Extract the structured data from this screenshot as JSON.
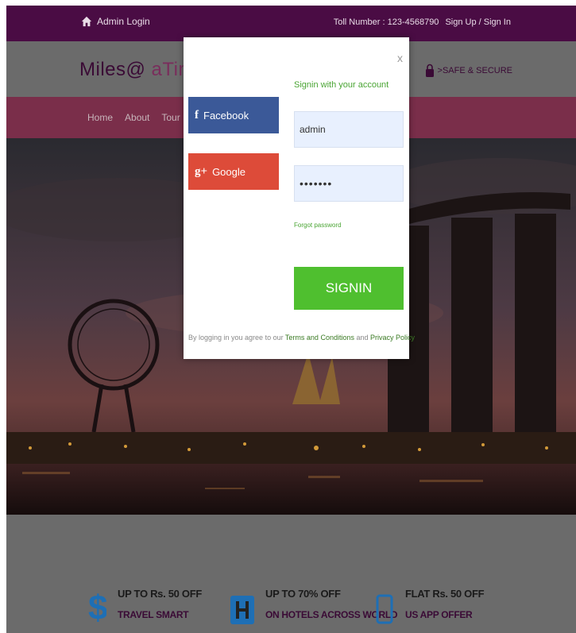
{
  "topbar": {
    "admin_login": "Admin Login",
    "toll_number": "Toll Number : 123-4568790",
    "signup_signin": "Sign Up / Sign In"
  },
  "brand": {
    "name_part1": "Miles@",
    "name_part2": " aTime",
    "secure_text": ">SAFE & SECURE"
  },
  "nav": {
    "items": [
      "Home",
      "About",
      "Tour Package"
    ]
  },
  "modal": {
    "close_symbol": "x",
    "facebook_label": "Facebook",
    "google_label": "Google",
    "heading": "Signin with your account",
    "username_value": "admin",
    "password_value": "•••••••",
    "forgot_password": "Forgot password",
    "signin_button": "SIGNIN",
    "terms_prefix": "By logging in you agree to our ",
    "terms_link": "Terms and Conditions",
    "terms_and": " and ",
    "privacy_link": "Privacy Policy"
  },
  "promos": [
    {
      "title": "UP TO Rs. 50 OFF",
      "subtitle": "TRAVEL SMART",
      "icon": "dollar-icon"
    },
    {
      "title": "UP TO 70% OFF",
      "subtitle": "ON HOTELS ACROSS WORLD",
      "icon": "hotel-icon"
    },
    {
      "title": "FLAT Rs. 50 OFF",
      "subtitle": "US APP OFFER",
      "icon": "phone-icon"
    }
  ],
  "colors": {
    "topbar": "#4a0c44",
    "nav": "#7a2e4a",
    "facebook": "#3b5998",
    "google": "#dd4b39",
    "signin": "#4fbf2f"
  }
}
